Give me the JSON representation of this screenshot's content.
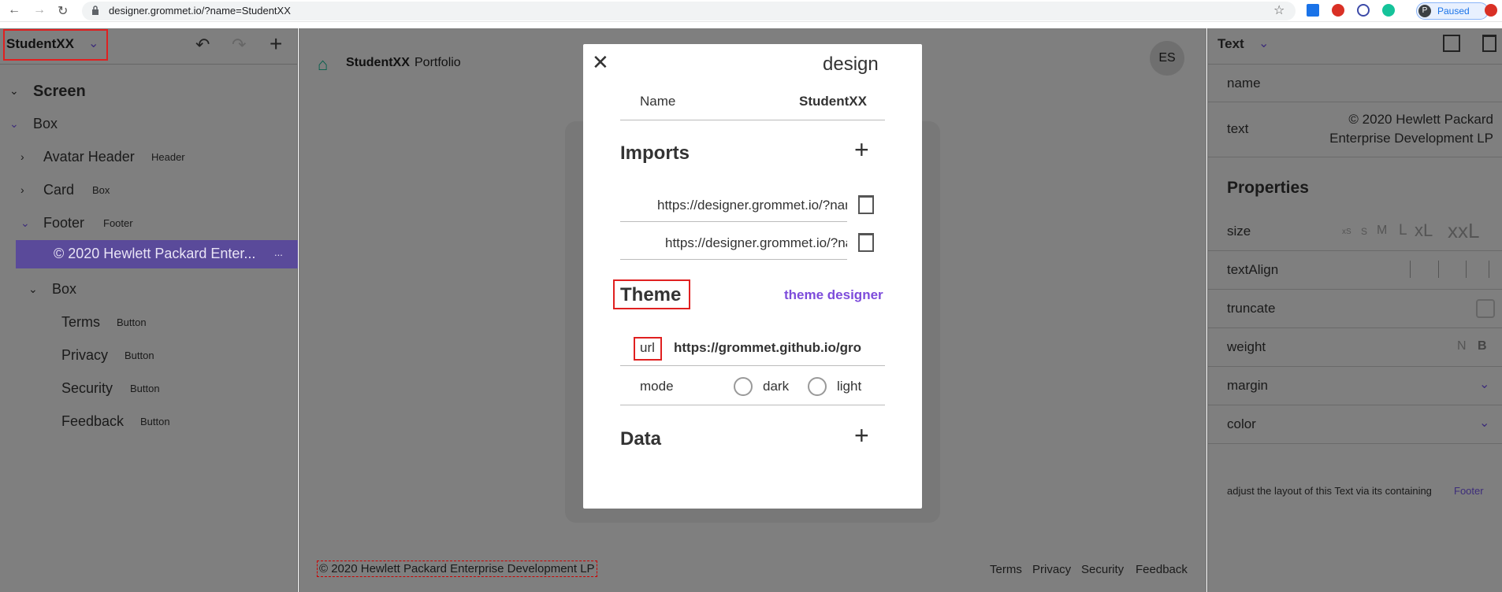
{
  "browser": {
    "url": "designer.grommet.io/?name=StudentXX",
    "paused_avatar": "P",
    "paused_label": "Paused"
  },
  "left_panel": {
    "project_name": "StudentXX",
    "tree": [
      {
        "label": "Screen",
        "type": "",
        "expanded": true
      },
      {
        "label": "Box",
        "type": "",
        "expanded": true
      },
      {
        "label": "Avatar Header",
        "type": "Header",
        "expanded": false
      },
      {
        "label": "Card",
        "type": "Box",
        "expanded": false
      },
      {
        "label": "Footer",
        "type": "Footer",
        "expanded": true
      },
      {
        "label": "© 2020 Hewlett Packard Enter...",
        "type": "...",
        "selected": true
      },
      {
        "label": "Box",
        "type": "",
        "expanded": true
      },
      {
        "label": "Terms",
        "type": "Button"
      },
      {
        "label": "Privacy",
        "type": "Button"
      },
      {
        "label": "Security",
        "type": "Button"
      },
      {
        "label": "Feedback",
        "type": "Button"
      }
    ]
  },
  "canvas": {
    "brand": "StudentXX",
    "brand_sub": "Portfolio",
    "avatar": "ES",
    "footer_text": "© 2020 Hewlett Packard Enterprise Development LP",
    "footer_links": [
      "Terms",
      "Privacy",
      "Security",
      "Feedback"
    ]
  },
  "modal": {
    "title": "design",
    "name_label": "Name",
    "name_value": "StudentXX",
    "imports_heading": "Imports",
    "imports": [
      "https://designer.grommet.io/?name=...",
      "https://designer.grommet.io/?name=..."
    ],
    "theme_heading": "Theme",
    "theme_designer_link": "theme designer",
    "url_label": "url",
    "theme_url": "https://grommet.github.io/grommet-theme-hpe",
    "mode_label": "mode",
    "mode_options": [
      "dark",
      "light"
    ],
    "data_heading": "Data"
  },
  "right_panel": {
    "component_type": "Text",
    "name_label": "name",
    "text_label": "text",
    "text_value": "© 2020 Hewlett Packard Enterprise Development LP",
    "properties_heading": "Properties",
    "size_label": "size",
    "size_options": [
      "xS",
      "S",
      "M",
      "L",
      "xL",
      "xxL"
    ],
    "textalign_label": "textAlign",
    "truncate_label": "truncate",
    "weight_label": "weight",
    "weight_options": [
      "N",
      "B"
    ],
    "margin_label": "margin",
    "color_label": "color",
    "hint_text": "adjust the layout of this Text via its containing",
    "hint_link": "Footer"
  },
  "colors": {
    "accent": "#7d4cdb",
    "highlight": "#e02020",
    "brand_green": "#01a982"
  }
}
